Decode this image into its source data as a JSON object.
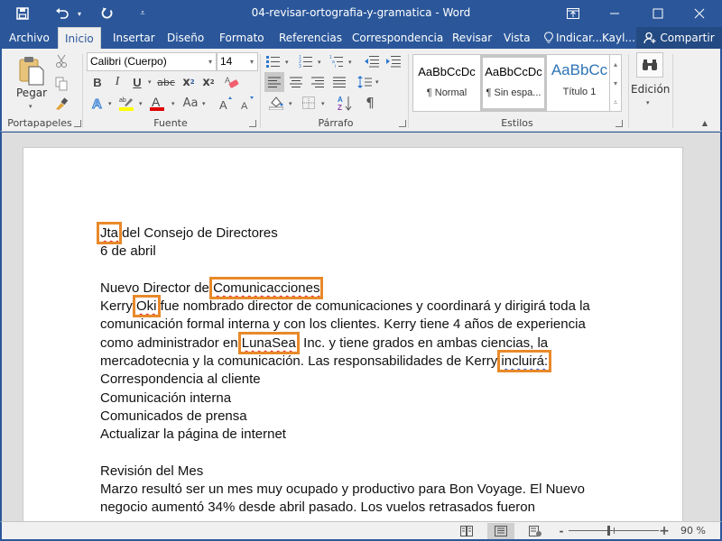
{
  "titlebar": {
    "title": "04-revisar-ortografia-y-gramatica - Word",
    "save_icon": "save-icon",
    "undo_icon": "undo-icon",
    "redo_icon": "repeat-icon",
    "customize_icon": "customize-qat-icon",
    "window_buttons": [
      "ribbon-display-options",
      "minimize",
      "maximize",
      "close"
    ]
  },
  "tabs": [
    {
      "label": "Archivo",
      "active": false
    },
    {
      "label": "Inicio",
      "active": true
    },
    {
      "label": "Insertar",
      "active": false
    },
    {
      "label": "Diseño",
      "active": false
    },
    {
      "label": "Formato",
      "active": false
    },
    {
      "label": "Referencias",
      "active": false
    },
    {
      "label": "Correspondencia",
      "active": false
    },
    {
      "label": "Revisar",
      "active": false
    },
    {
      "label": "Vista",
      "active": false
    }
  ],
  "tell_me": "Indicar...",
  "user": "Kayl...",
  "share": "Compartir",
  "ribbon": {
    "clipboard": {
      "label": "Portapapeles",
      "paste": "Pegar"
    },
    "font": {
      "label": "Fuente",
      "font_name": "Calibri (Cuerpo)",
      "font_size": "14",
      "bold": "B",
      "italic": "I",
      "underline": "U",
      "strike": "abc",
      "change_case": "Aa",
      "highlight_color": "#ffff00",
      "font_color": "#e00000"
    },
    "paragraph": {
      "label": "Párrafo",
      "pilcrow": "¶"
    },
    "styles": {
      "label": "Estilos",
      "items": [
        {
          "sample": "AaBbCcDc",
          "name": "¶ Normal",
          "selected": false
        },
        {
          "sample": "AaBbCcDc",
          "name": "¶ Sin espa...",
          "selected": true
        },
        {
          "sample": "AaBbCc",
          "name": "Título 1",
          "selected": false
        }
      ]
    },
    "editing": {
      "label": "Edición"
    }
  },
  "document": {
    "lines": [
      [
        {
          "t": "Jta",
          "err": "spell",
          "hl": true
        },
        {
          "t": " del Consejo de Directores"
        }
      ],
      [
        {
          "t": " 6 de abril"
        }
      ],
      [
        {
          "t": ""
        }
      ],
      [
        {
          "t": " Nuevo Director de "
        },
        {
          "t": "Comunicacciones",
          "err": "spell",
          "hl": true
        }
      ],
      [
        {
          "t": "Kerry "
        },
        {
          "t": "Oki",
          "err": "spell",
          "hl": true
        },
        {
          "t": " fue nombrado director de comunicaciones y coordinará y dirigirá toda la"
        }
      ],
      [
        {
          "t": "comunicación formal interna y con los clientes. Kerry tiene 4 años de experiencia"
        }
      ],
      [
        {
          "t": "como administrador en "
        },
        {
          "t": "LunaSea",
          "err": "spell",
          "hl": true
        },
        {
          "t": ", Inc. y tiene grados en ambas ciencias, la"
        }
      ],
      [
        {
          "t": "mercadotecnia y la comunicación. Las responsabilidades de Kerry "
        },
        {
          "t": "incluirá:",
          "err": "grammar",
          "hl": true
        }
      ],
      [
        {
          "t": "Correspondencia al cliente"
        }
      ],
      [
        {
          "t": "Comunicación interna"
        }
      ],
      [
        {
          "t": "Comunicados de prensa"
        }
      ],
      [
        {
          "t": "Actualizar la página de internet"
        }
      ],
      [
        {
          "t": ""
        }
      ],
      [
        {
          "t": "Revisión del Mes"
        }
      ],
      [
        {
          "t": "Marzo resultó ser un mes muy ocupado y productivo para Bon Voyage. El Nuevo"
        }
      ],
      [
        {
          "t": "negocio aumentó 34% desde abril pasado. Los vuelos retrasados fueron"
        }
      ]
    ]
  },
  "statusbar": {
    "views": [
      "read-mode",
      "print-layout",
      "web-layout"
    ],
    "active_view": "print-layout",
    "zoom_minus": "-",
    "zoom_plus": "+",
    "zoom_percent": 90,
    "zoom_label": "90 %"
  },
  "colors": {
    "brand": "#2b579a",
    "highlight_box": "#e8892a",
    "spell_error": "#e02020",
    "grammar_error": "#2b5de0"
  }
}
